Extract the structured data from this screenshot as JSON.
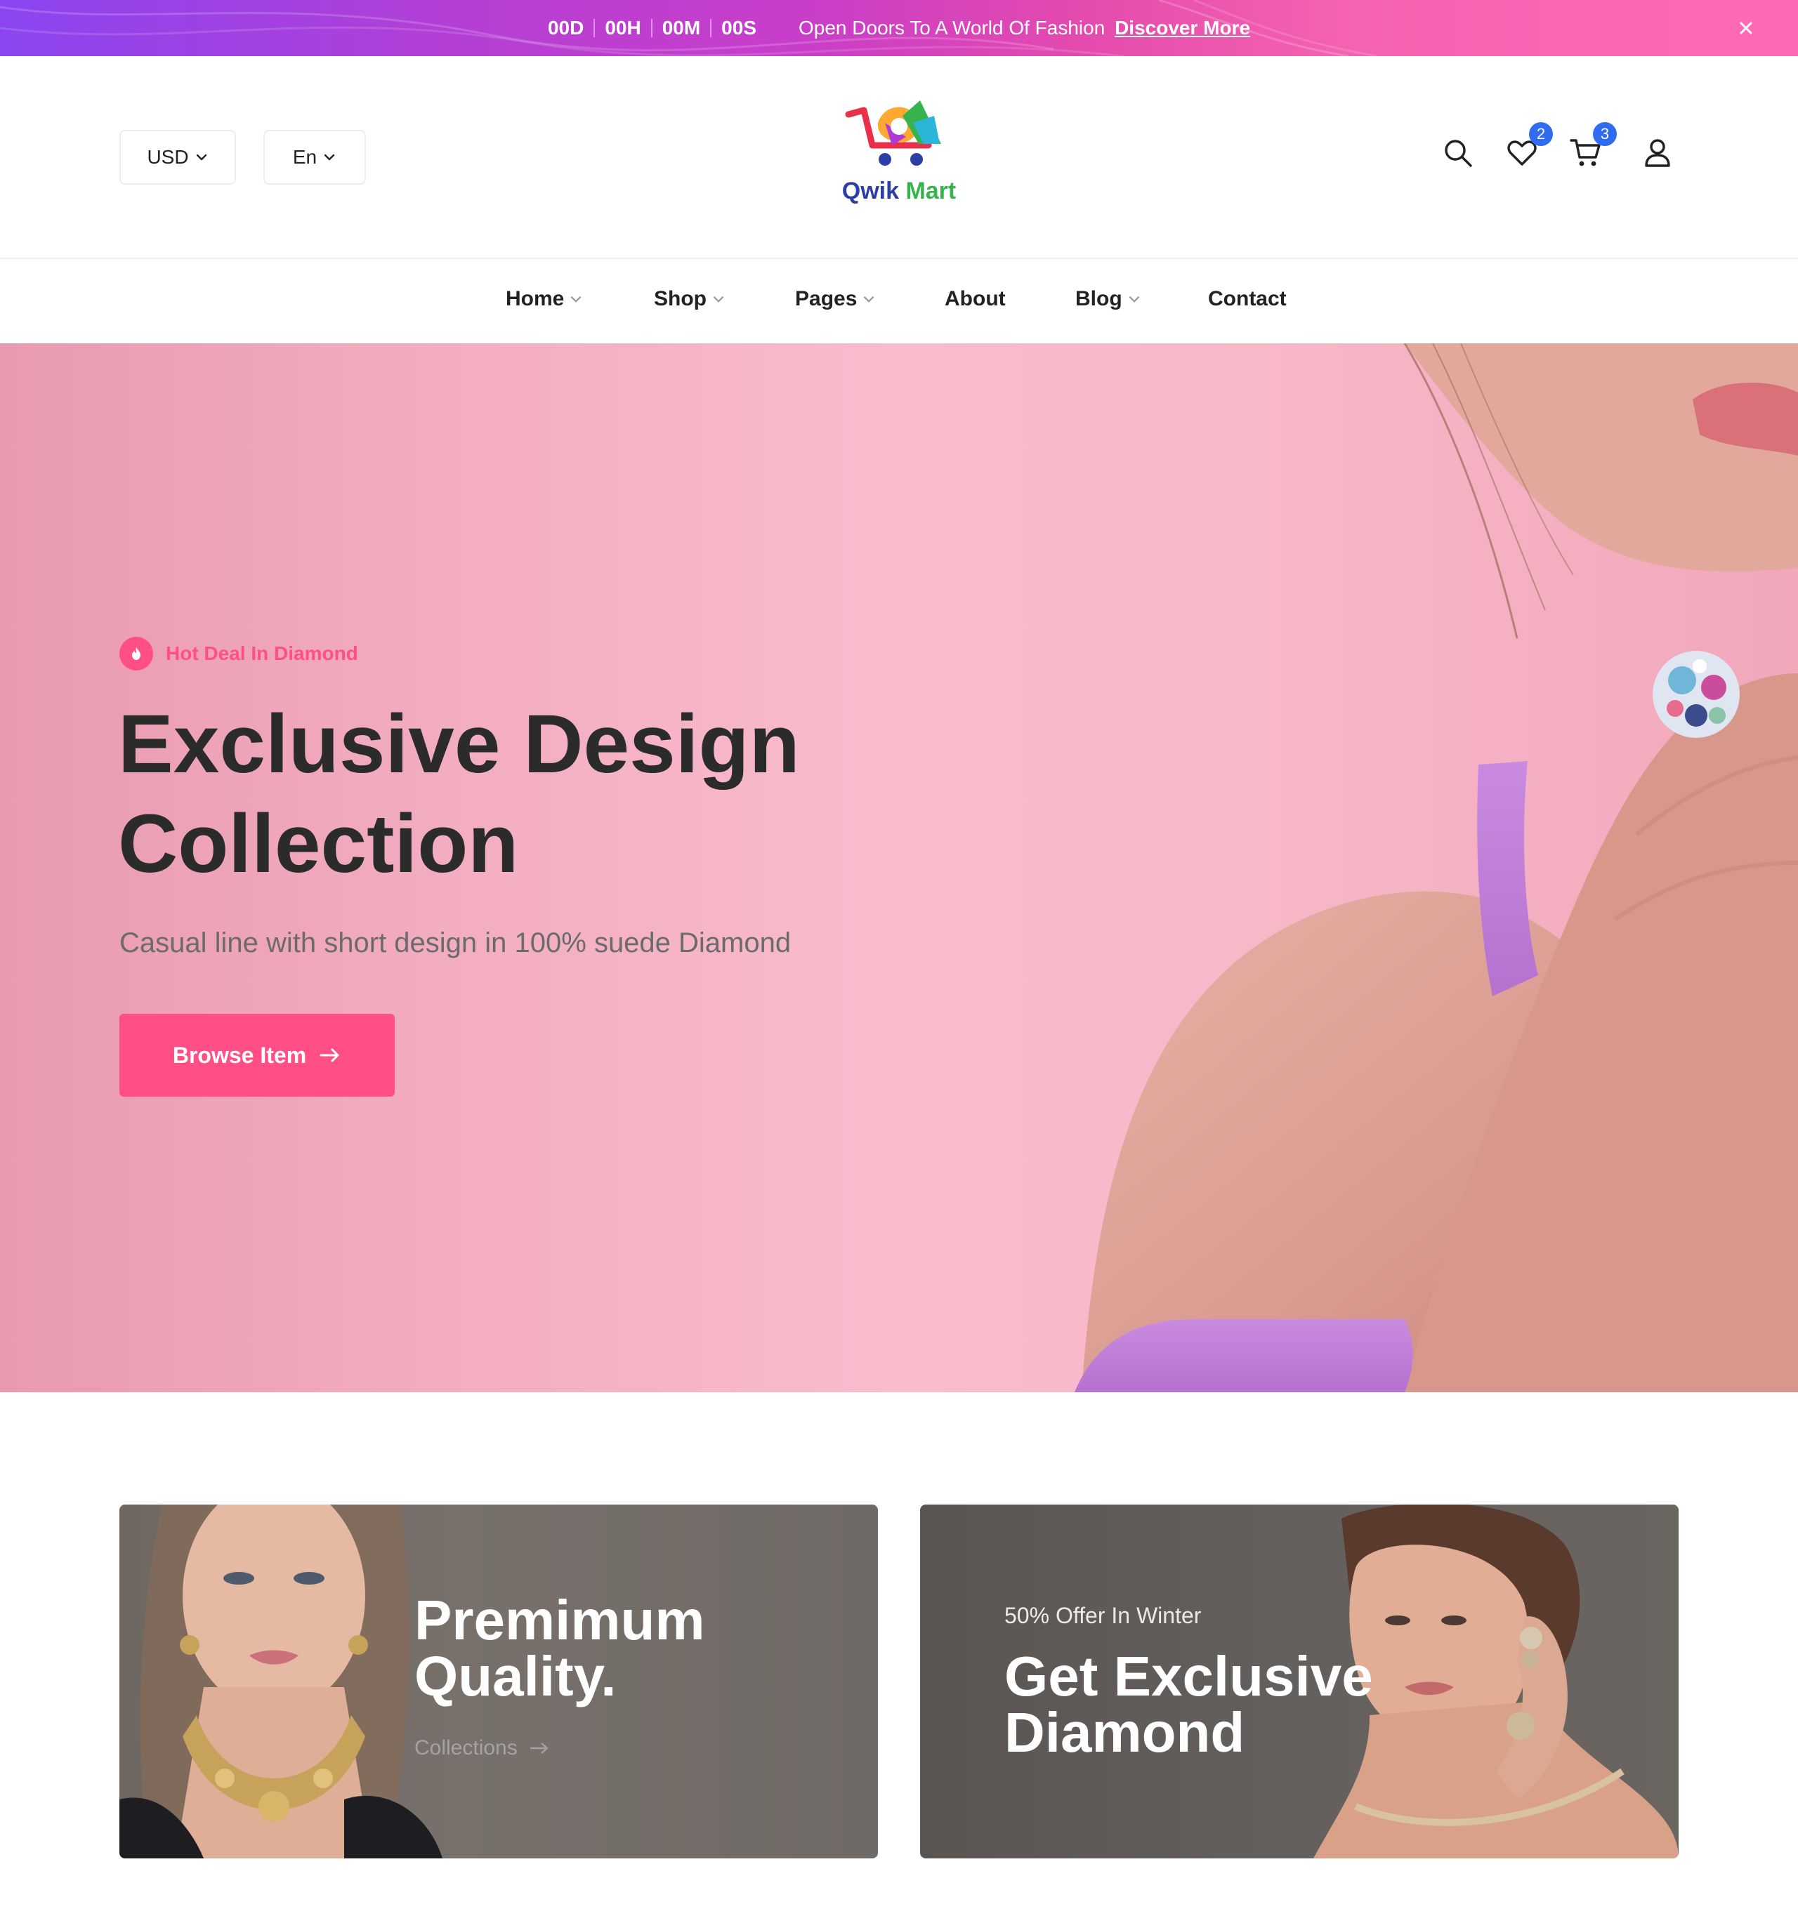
{
  "announcement": {
    "countdown": [
      "00D",
      "00H",
      "00M",
      "00S"
    ],
    "text": "Open Doors To A World Of Fashion",
    "link": "Discover More"
  },
  "header": {
    "currency": "USD",
    "language": "En",
    "logo_first": "Qwik",
    "logo_second": "Mart",
    "wishlist_count": "2",
    "cart_count": "3"
  },
  "nav": {
    "items": [
      {
        "label": "Home",
        "dropdown": true
      },
      {
        "label": "Shop",
        "dropdown": true
      },
      {
        "label": "Pages",
        "dropdown": true
      },
      {
        "label": "About",
        "dropdown": false
      },
      {
        "label": "Blog",
        "dropdown": true
      },
      {
        "label": "Contact",
        "dropdown": false
      }
    ]
  },
  "hero": {
    "kicker": "Hot Deal In Diamond",
    "title_line1": "Exclusive Design",
    "title_line2": "Collection",
    "subtitle": "Casual line with short design in 100% suede Diamond",
    "button": "Browse Item"
  },
  "promos": [
    {
      "title_line1": "Premimum",
      "title_line2": "Quality.",
      "link": "Collections"
    },
    {
      "kicker": "50% Offer In Winter",
      "title_line1": "Get Exclusive",
      "title_line2": "Diamond"
    }
  ],
  "colors": {
    "accent": "#ff4f86",
    "badge": "#2f6cf0",
    "text_dark": "#2b2b2b"
  }
}
